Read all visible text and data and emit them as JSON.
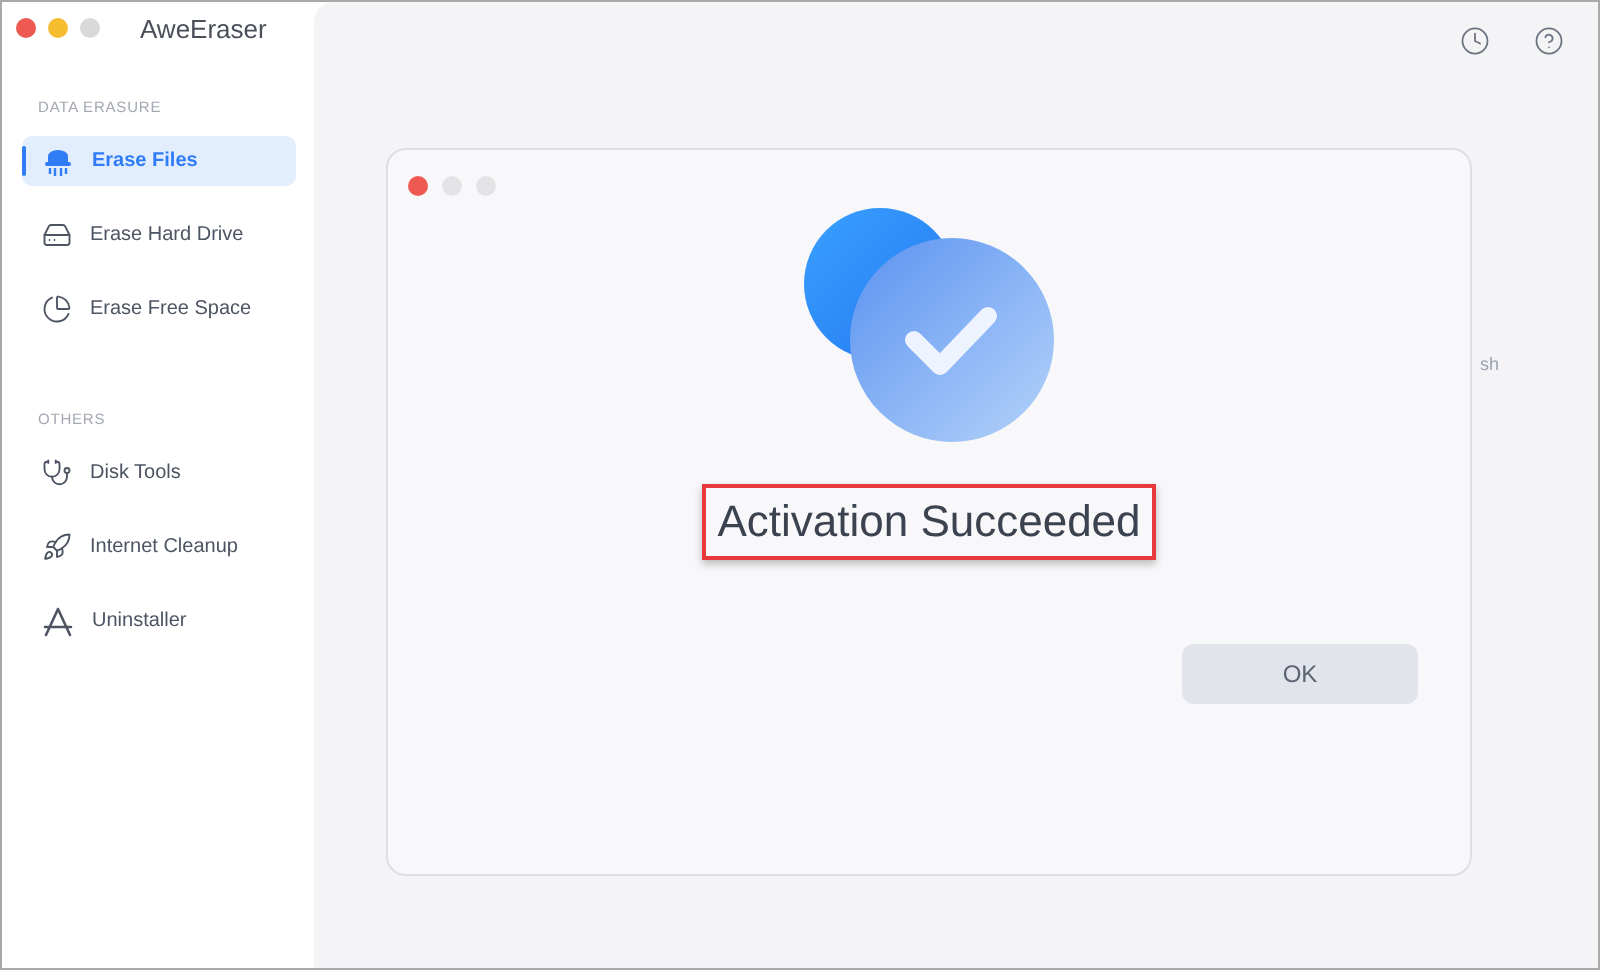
{
  "window": {
    "title": "AweEraser"
  },
  "sidebar": {
    "sections": [
      {
        "heading": "DATA ERASURE",
        "items": [
          {
            "label": "Erase Files",
            "selected": true
          },
          {
            "label": "Erase Hard Drive",
            "selected": false
          },
          {
            "label": "Erase Free Space",
            "selected": false
          }
        ]
      },
      {
        "heading": "OTHERS",
        "items": [
          {
            "label": "Disk Tools",
            "selected": false
          },
          {
            "label": "Internet Cleanup",
            "selected": false
          },
          {
            "label": "Uninstaller",
            "selected": false
          }
        ]
      }
    ]
  },
  "background_text": "sh",
  "dialog": {
    "title": "Activation Succeeded",
    "title_highlighted": true,
    "button": "OK"
  }
}
